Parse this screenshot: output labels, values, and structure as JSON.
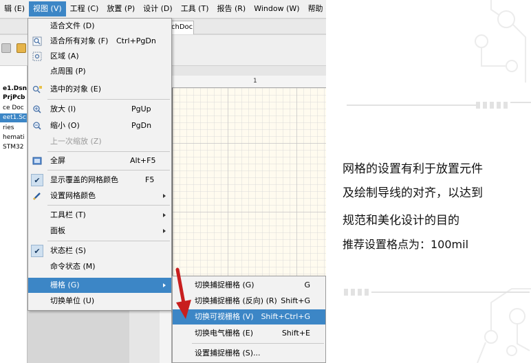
{
  "menubar": {
    "items": [
      {
        "label": "辑 (E)"
      },
      {
        "label": "视图 (V)",
        "active": true
      },
      {
        "label": "工程 (C)"
      },
      {
        "label": "放置 (P)"
      },
      {
        "label": "设计 (D)"
      },
      {
        "label": "工具 (T)"
      },
      {
        "label": "报告 (R)"
      },
      {
        "label": "Window (W)"
      },
      {
        "label": "帮助 ("
      }
    ]
  },
  "document_tab": {
    "label": "chDoc"
  },
  "projects_panel": {
    "rows": [
      "e1.Dsn",
      "PrjPcb",
      "ce Doc",
      "eet1.Sc",
      "ries",
      "hemati",
      "STM32"
    ]
  },
  "ruler": {
    "label": "1"
  },
  "view_menu": {
    "items": [
      {
        "label": "适合文件 (D)",
        "shortcut": "",
        "icon": "fit-document-icon"
      },
      {
        "label": "适合所有对象 (F)",
        "shortcut": "Ctrl+PgDn",
        "icon": "fit-all-objects-icon"
      },
      {
        "label": "区域 (A)",
        "shortcut": "",
        "icon": "area-zoom-icon"
      },
      {
        "label": "点周围 (P)",
        "shortcut": "",
        "icon": ""
      },
      {
        "label": "选中的对象 (E)",
        "shortcut": "",
        "icon": "selected-objects-icon"
      },
      {
        "label": "放大 (I)",
        "shortcut": "PgUp",
        "icon": "zoom-in-icon"
      },
      {
        "label": "缩小 (O)",
        "shortcut": "PgDn",
        "icon": "zoom-out-icon"
      },
      {
        "label": "上一次缩放 (Z)",
        "shortcut": "",
        "icon": "",
        "disabled": true
      },
      {
        "label": "全屏",
        "shortcut": "Alt+F5",
        "icon": "fullscreen-icon"
      },
      {
        "label": "显示覆盖的网格颜色",
        "shortcut": "F5",
        "icon": "checkmark-icon"
      },
      {
        "label": "设置网格颜色",
        "shortcut": "",
        "icon": "pen-icon",
        "submenu": true
      },
      {
        "label": "工具栏 (T)",
        "shortcut": "",
        "submenu": true
      },
      {
        "label": "面板",
        "shortcut": "",
        "submenu": true
      },
      {
        "label": "状态栏 (S)",
        "shortcut": "",
        "icon": "checkmark-icon"
      },
      {
        "label": "命令状态 (M)",
        "shortcut": ""
      },
      {
        "label": "栅格 (G)",
        "shortcut": "",
        "submenu": true,
        "highlighted": true
      },
      {
        "label": "切换单位 (U)",
        "shortcut": ""
      }
    ]
  },
  "grid_menu": {
    "items": [
      {
        "label": "切换捕捉栅格 (G)",
        "shortcut": "G"
      },
      {
        "label": "切换捕捉栅格 (反向) (R)",
        "shortcut": "Shift+G"
      },
      {
        "label": "切换可视栅格 (V)",
        "shortcut": "Shift+Ctrl+G",
        "highlighted": true
      },
      {
        "label": "切换电气栅格 (E)",
        "shortcut": "Shift+E"
      },
      {
        "label": "设置捕捉栅格 (S)...",
        "shortcut": ""
      }
    ]
  },
  "description": {
    "lines": [
      "网格的设置有利于放置元件",
      "及绘制导线的对齐，以达到",
      "规范和美化设计的目的",
      "推荐设置格点为：100mil"
    ]
  },
  "colors": {
    "highlight": "#3c86c6",
    "arrow": "#c81e1e",
    "menu_bg": "#f2f2f2"
  }
}
